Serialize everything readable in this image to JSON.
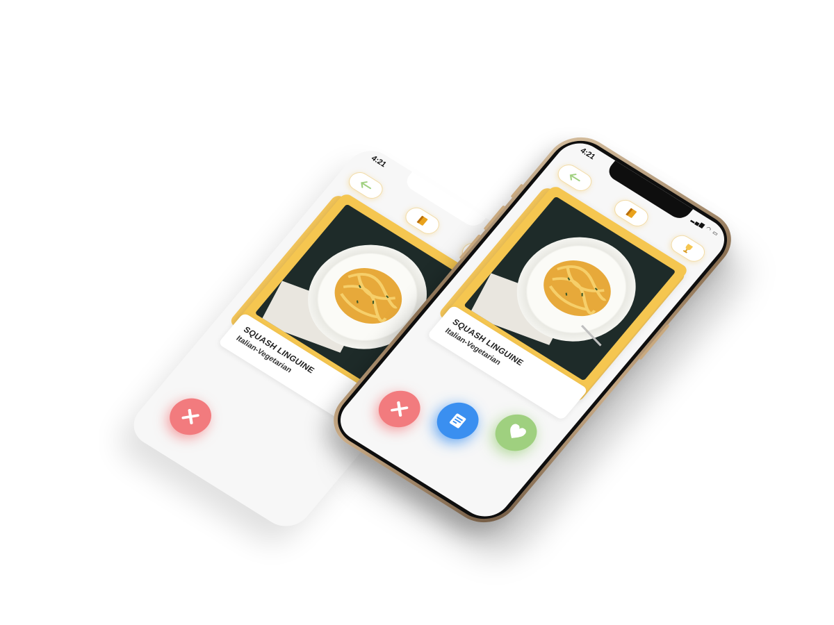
{
  "colors": {
    "accent_yellow": "#F5C650",
    "reject_red": "#F27B7E",
    "recipe_blue": "#3A8FF0",
    "like_green": "#9FD07F",
    "screen_bg": "#F7F7F7",
    "phone_frame": "#C9A97F"
  },
  "status_bar": {
    "time": "4:21",
    "icons": [
      "signal-icon",
      "wifi-icon",
      "battery-icon"
    ]
  },
  "top_bar": {
    "back_icon": "back-arrow-icon",
    "book_icon": "book-icon",
    "trophy_icon": "trophy-icon"
  },
  "recipe": {
    "name": "SQUASH LINGUINE",
    "category": "Italian-Vegetarian",
    "image": "pasta-photo"
  },
  "actions": {
    "reject_icon": "close-icon",
    "recipe_icon": "recipe-card-icon",
    "like_icon": "heart-icon"
  },
  "back_screen": {
    "time": "4:21",
    "name": "SQUASH LINGUINE",
    "category": "Italian-Vegetarian",
    "obscured_prefix": "Ita"
  }
}
